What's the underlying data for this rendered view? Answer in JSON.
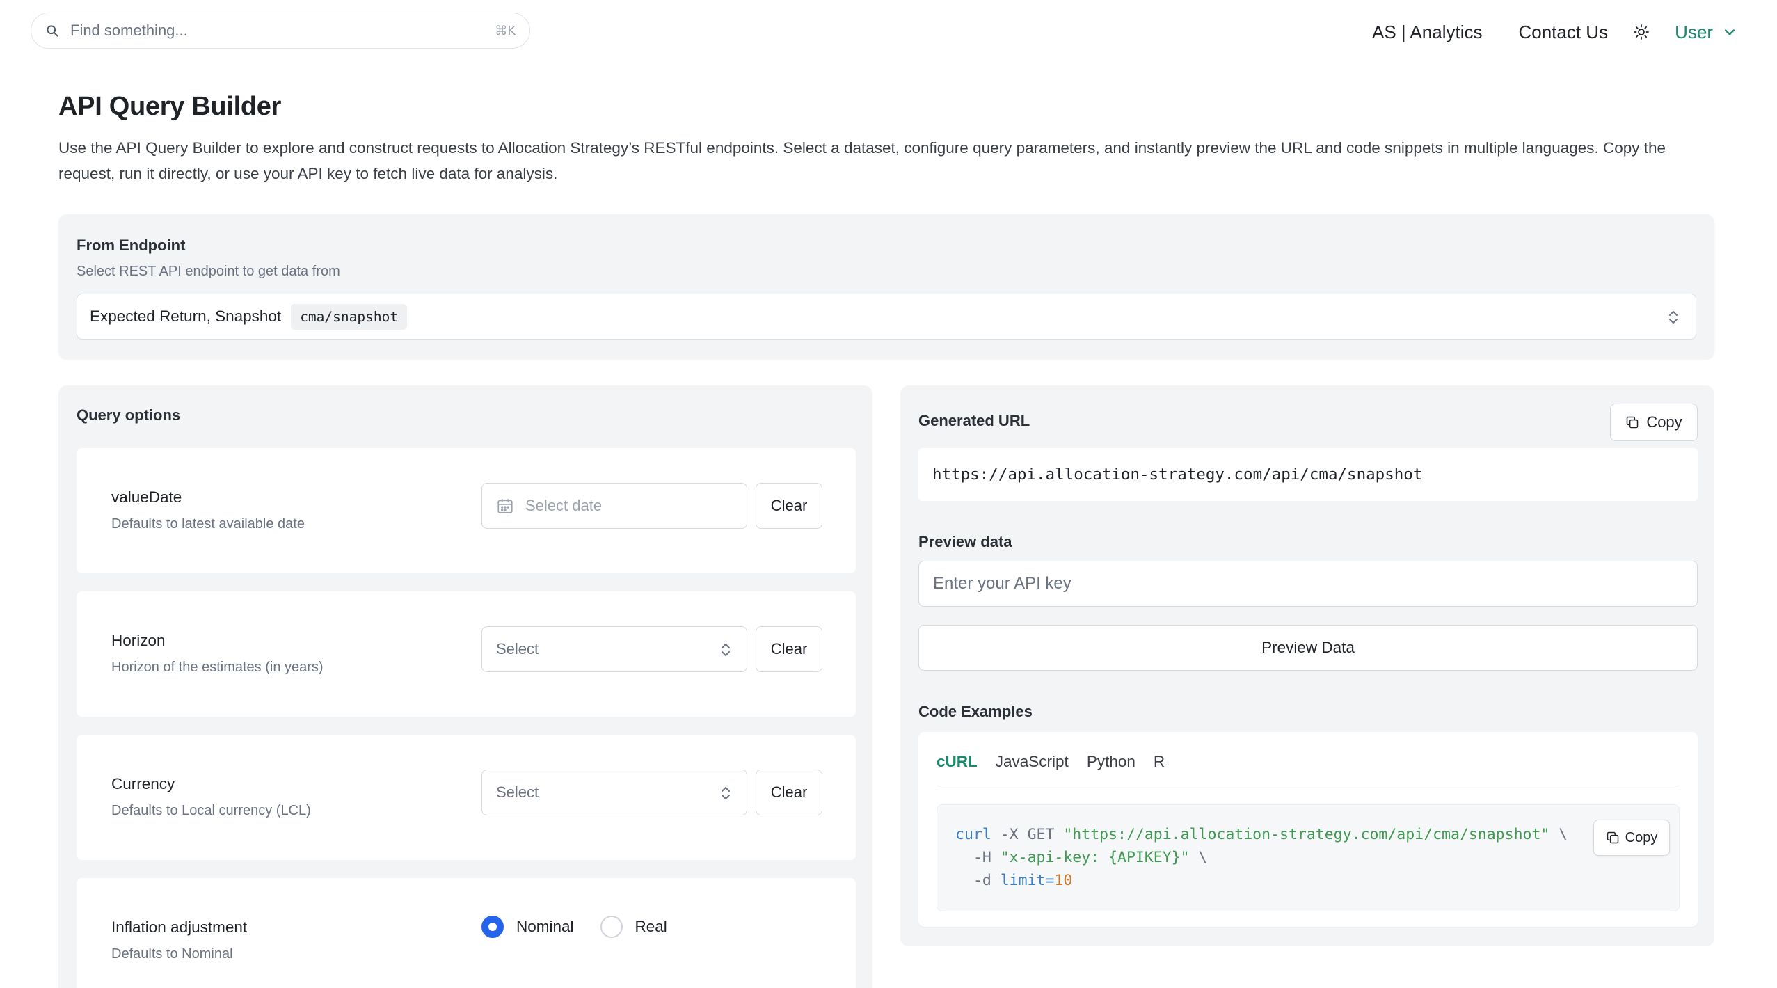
{
  "header": {
    "search_placeholder": "Find something...",
    "search_shortcut": "⌘K",
    "nav": [
      "AS | Analytics",
      "Contact Us"
    ],
    "user_label": "User"
  },
  "page": {
    "title": "API Query Builder",
    "description": "Use the API Query Builder to explore and construct requests to Allocation Strategy’s RESTful endpoints. Select a dataset, configure query parameters, and instantly preview the URL and code snippets in multiple languages. Copy the request, run it directly, or use your API key to fetch live data for analysis."
  },
  "endpoint": {
    "label": "From Endpoint",
    "help": "Select REST API endpoint to get data from",
    "selected_name": "Expected Return, Snapshot",
    "selected_path": "cma/snapshot"
  },
  "query": {
    "title": "Query options",
    "clear_label": "Clear",
    "options": [
      {
        "name": "valueDate",
        "help": "Defaults to latest available date",
        "placeholder": "Select date"
      },
      {
        "name": "Horizon",
        "help": "Horizon of the estimates (in years)",
        "placeholder": "Select"
      },
      {
        "name": "Currency",
        "help": "Defaults to Local currency (LCL)",
        "placeholder": "Select"
      },
      {
        "name": "Inflation adjustment",
        "help": "Defaults to Nominal"
      }
    ],
    "inflation_choices": [
      "Nominal",
      "Real"
    ],
    "inflation_selected": "Nominal"
  },
  "output": {
    "url_label": "Generated URL",
    "copy_label": "Copy",
    "url": "https://api.allocation-strategy.com/api/cma/snapshot",
    "preview_label": "Preview data",
    "api_key_placeholder": "Enter your API key",
    "preview_button": "Preview Data",
    "code_label": "Code Examples",
    "tabs": [
      "cURL",
      "JavaScript",
      "Python",
      "R"
    ],
    "active_tab": "cURL",
    "code": {
      "cmd": "curl",
      "method_flag": "-X GET",
      "url_string": "\"https://api.allocation-strategy.com/api/cma/snapshot\"",
      "cont": "\\",
      "header_flag": "-H",
      "header_string": "\"x-api-key: {APIKEY}\"",
      "data_flag": "-d",
      "data_key": "limit=",
      "data_value": "10"
    }
  },
  "colors": {
    "accent_green": "#1a8a6e",
    "radio_blue": "#2563eb"
  }
}
